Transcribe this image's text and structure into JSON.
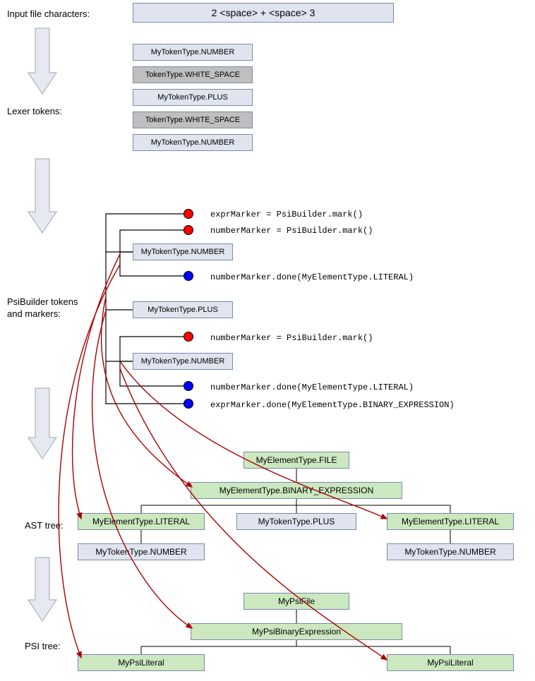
{
  "labels": {
    "input": "Input file characters:",
    "lexer": "Lexer tokens:",
    "psib": "PsiBuilder tokens\nand markers:",
    "ast": "AST tree:",
    "psi": "PSI tree:"
  },
  "inputBox": "2 <space> + <space> 3",
  "lexerTokens": [
    "MyTokenType.NUMBER",
    "TokenType.WHITE_SPACE",
    "MyTokenType.PLUS",
    "TokenType.WHITE_SPACE",
    "MyTokenType.NUMBER"
  ],
  "markerTokens": {
    "num1": "MyTokenType.NUMBER",
    "plus": "MyTokenType.PLUS",
    "num2": "MyTokenType.NUMBER"
  },
  "markerCode": {
    "c1": "exprMarker = PsiBuilder.mark()",
    "c2": "numberMarker = PsiBuilder.mark()",
    "c3": "numberMarker.done(MyElementType.LITERAL)",
    "c4": "numberMarker = PsiBuilder.mark()",
    "c5": "numberMarker.done(MyElementType.LITERAL)",
    "c6": "exprMarker.done(MyElementType.BINARY_EXPRESSION)"
  },
  "ast": {
    "file": "MyElementType.FILE",
    "bin": "MyElementType.BINARY_EXPRESSION",
    "litL": "MyElementType.LITERAL",
    "plus": "MyTokenType.PLUS",
    "litR": "MyElementType.LITERAL",
    "numL": "MyTokenType.NUMBER",
    "numR": "MyTokenType.NUMBER"
  },
  "psi": {
    "file": "MyPsiFile",
    "bin": "MyPsiBinaryExpression",
    "litL": "MyPsiLiteral",
    "litR": "MyPsiLiteral"
  }
}
